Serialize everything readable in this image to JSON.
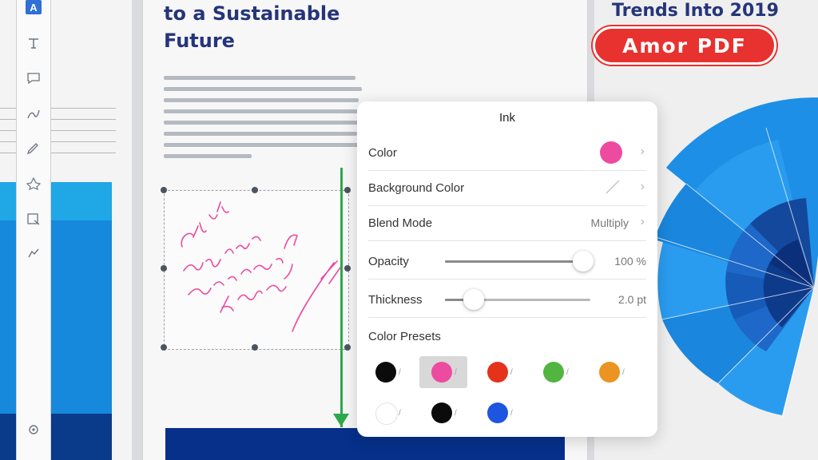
{
  "app": {
    "brand": "Amor PDF"
  },
  "left_page": {
    "table_rows": [
      {
        "label": "",
        "value": ""
      },
      {
        "label": "",
        "value": ""
      },
      {
        "label": "",
        "value": ""
      },
      {
        "label": "",
        "value": ""
      }
    ]
  },
  "toolbar": {
    "tools": [
      "app-icon",
      "text-tool-icon",
      "comment-icon",
      "draw-icon",
      "pen-icon",
      "shape-icon",
      "stamp-icon",
      "signature-icon",
      "settings-icon"
    ]
  },
  "document": {
    "heading_line1": "to a Sustainable",
    "heading_line2": "Future"
  },
  "right_page": {
    "heading": "Trends Into 2019"
  },
  "ink_popover": {
    "title": "Ink",
    "color_label": "Color",
    "color_value": "#ec4b9f",
    "background_label": "Background Color",
    "blend_label": "Blend Mode",
    "blend_value": "Multiply",
    "opacity_label": "Opacity",
    "opacity_value": "100 %",
    "opacity_fraction": 0.95,
    "thickness_label": "Thickness",
    "thickness_value": "2.0 pt",
    "thickness_fraction": 0.2,
    "presets_label": "Color Presets",
    "presets_row1": [
      "#0b0b0b",
      "#ec4b9f",
      "#e5321b",
      "#52b540",
      "#eb9421"
    ],
    "presets_row2": [
      "#ffffff",
      "#0b0b0b",
      "#1e55e0"
    ],
    "selected_preset": 1
  },
  "colors": {
    "accent_blue": "#1689dc",
    "dark_blue": "#0a3a8a",
    "annotation_pink": "#ec4b9f",
    "arrow_green": "#2ea94a",
    "brand_red": "#e8322f"
  }
}
